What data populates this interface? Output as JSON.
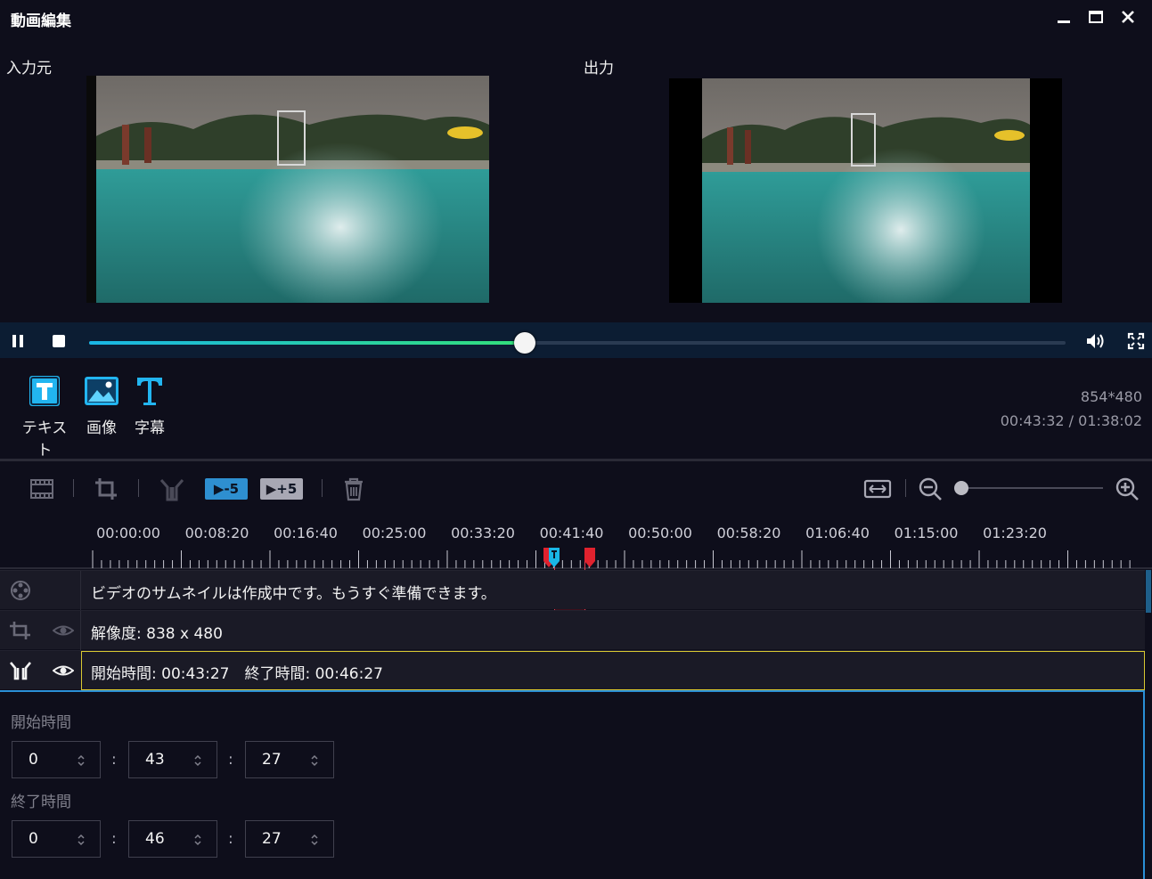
{
  "window": {
    "title": "動画編集"
  },
  "preview": {
    "input_label": "入力元",
    "output_label": "出力"
  },
  "player": {
    "progress": 0.446
  },
  "tools": [
    {
      "label": "テキスト",
      "icon": "text-box-icon"
    },
    {
      "label": "画像",
      "icon": "image-icon"
    },
    {
      "label": "字幕",
      "icon": "subtitle-t-icon"
    }
  ],
  "info": {
    "resolution": "854*480",
    "time": "00:43:32 / 01:38:02"
  },
  "toolbar": {
    "rewind_label": "-5",
    "forward_label": "+5",
    "zoom_level": 0.0
  },
  "timeline": {
    "ticks": [
      "00:00:00",
      "00:08:20",
      "00:16:40",
      "00:25:00",
      "00:33:20",
      "00:41:40",
      "00:50:00",
      "00:58:20",
      "01:06:40",
      "01:15:00",
      "01:23:20"
    ],
    "tracks": [
      {
        "text": "ビデオのサムネイルは作成中です。もうすぐ準備できます。"
      },
      {
        "text": "解像度: 838 x 480"
      },
      {
        "text": "開始時間: 00:43:27　終了時間: 00:46:27"
      }
    ]
  },
  "trim": {
    "start_label": "開始時間",
    "end_label": "終了時間",
    "start": [
      "0",
      "43",
      "27"
    ],
    "end": [
      "0",
      "46",
      "27"
    ],
    "separator": ":"
  },
  "colors": {
    "accent": "#19b6e6",
    "marker": "#e0222e",
    "selected_border": "#d8c832"
  }
}
